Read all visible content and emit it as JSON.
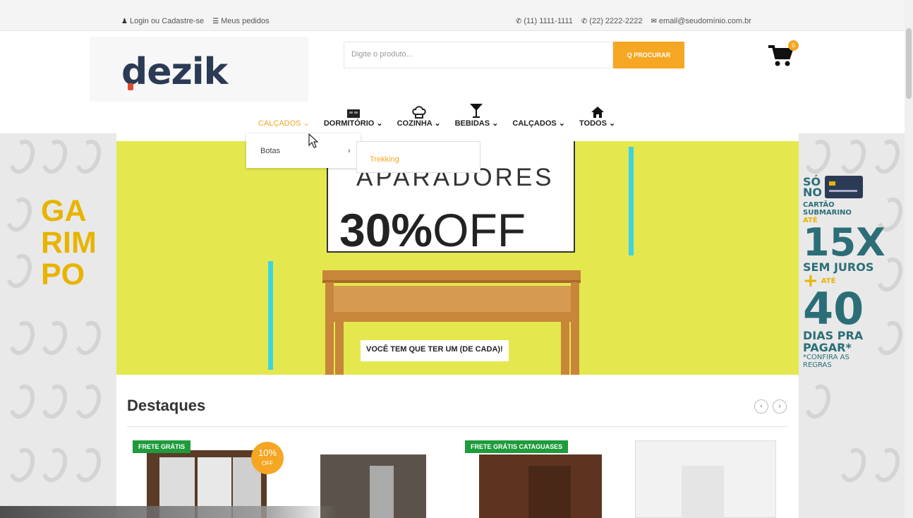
{
  "topbar": {
    "login": "Login ou Cadastre-se",
    "orders": "Meus pedidos",
    "phone1": "(11) 1111-1111",
    "phone2": "(22) 2222-2222",
    "email": "email@seudomínio.com.br"
  },
  "header": {
    "logo": "dezik",
    "search_placeholder": "Digite o produto...",
    "search_button": "Q PROCURAR",
    "cart_count": "0"
  },
  "nav": {
    "items": [
      {
        "label": "CALÇADOS",
        "icon": "none",
        "active": true
      },
      {
        "label": "DORMITÓRIO",
        "icon": "bed-icon"
      },
      {
        "label": "COZINHA",
        "icon": "chef-hat-icon"
      },
      {
        "label": "BEBIDAS",
        "icon": "cocktail-icon"
      },
      {
        "label": "CALÇADOS",
        "icon": "none"
      },
      {
        "label": "TODOS",
        "icon": "home-icon"
      }
    ]
  },
  "dropdown": {
    "item": "Botas",
    "submenu_item": "Trekking"
  },
  "side_left": {
    "line1": "GA",
    "line2": "RIM",
    "line3": "PO"
  },
  "side_right": {
    "so": "SÓ",
    "no": "NO",
    "cartao": "CARTÃO",
    "submarino": "SUBMARINO",
    "ate1": "ATÉ",
    "x15": "15X",
    "sem_juros": "SEM JUROS",
    "plus": "+",
    "ate2": "ATÉ",
    "n40": "40",
    "dias": "DIAS PRA",
    "pagar": "PAGAR*",
    "confira": "*CONFIRA AS",
    "regras": "REGRAS"
  },
  "hero": {
    "title": "APARADORES",
    "off_bold": "30%",
    "off_light": "OFF",
    "tagline": "VOCÊ TEM QUE TER UM (DE CADA)!"
  },
  "destaques": {
    "title": "Destaques",
    "prev": "‹",
    "next": "›",
    "products": [
      {
        "badge": "FRETE GRÁTIS",
        "discount": "10%",
        "discount_small": "OFF"
      },
      {
        "badge": ""
      },
      {
        "badge": "FRETE GRÁTIS CATAGUASES"
      },
      {
        "badge": ""
      }
    ]
  },
  "colors": {
    "accent": "#f5a623",
    "hero_bg": "#e4e84e",
    "brand_navy": "#2b3a55",
    "badge_green": "#1e9b3c",
    "promo_teal": "#2c6e77"
  }
}
